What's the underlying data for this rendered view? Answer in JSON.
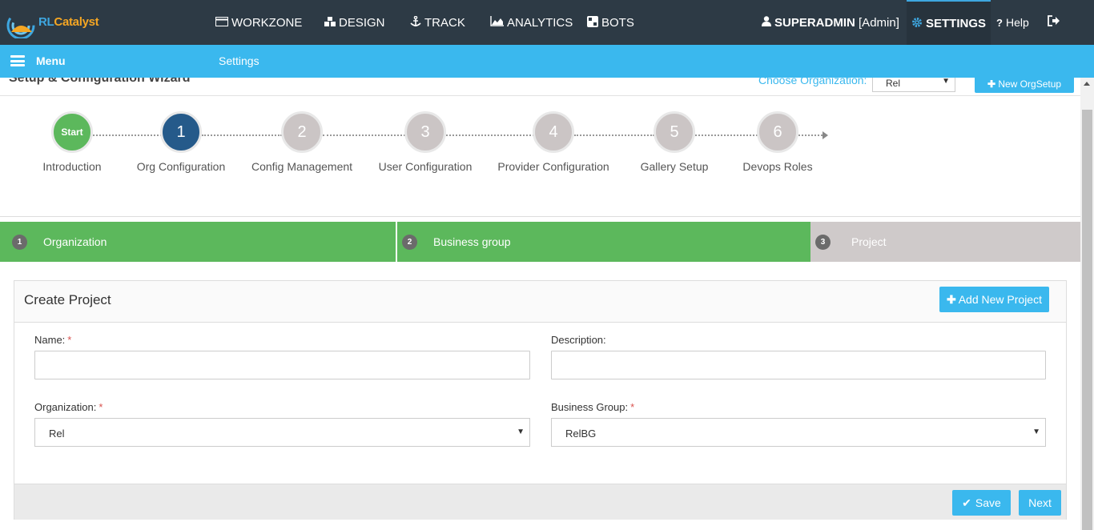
{
  "brand": {
    "name_part1": "RL",
    "name_part2": "Catalyst"
  },
  "topnav": {
    "items": [
      {
        "label": "WORKZONE",
        "icon": "card-icon"
      },
      {
        "label": "DESIGN",
        "icon": "cubes-icon"
      },
      {
        "label": "TRACK",
        "icon": "anchor-icon"
      },
      {
        "label": "ANALYTICS",
        "icon": "area-chart-icon"
      },
      {
        "label": "BOTS",
        "icon": "bots-icon"
      }
    ],
    "user": {
      "name": "SUPERADMIN",
      "role": "[Admin]"
    },
    "settings_label": "SETTINGS",
    "help_label": "Help"
  },
  "menubar": {
    "menu_label": "Menu",
    "breadcrumb": "Settings"
  },
  "wizard": {
    "title": "Setup & Configuration Wizard",
    "choose_org_label": "Choose Organization:",
    "org_selected": "Rel",
    "new_org_button": "New OrgSetup",
    "steps": [
      {
        "marker": "Start",
        "label": "Introduction",
        "state": "done"
      },
      {
        "marker": "1",
        "label": "Org Configuration",
        "state": "active"
      },
      {
        "marker": "2",
        "label": "Config Management",
        "state": "pending"
      },
      {
        "marker": "3",
        "label": "User Configuration",
        "state": "pending"
      },
      {
        "marker": "4",
        "label": "Provider Configuration",
        "state": "pending"
      },
      {
        "marker": "5",
        "label": "Gallery Setup",
        "state": "pending"
      },
      {
        "marker": "6",
        "label": "Devops Roles",
        "state": "pending"
      }
    ],
    "substeps": [
      {
        "num": "1",
        "label": "Organization",
        "state": "done"
      },
      {
        "num": "2",
        "label": "Business group",
        "state": "done"
      },
      {
        "num": "3",
        "label": "Project",
        "state": "current"
      }
    ]
  },
  "form": {
    "title": "Create Project",
    "add_button": "Add New Project",
    "name_label": "Name:",
    "name_value": "",
    "description_label": "Description:",
    "description_value": "",
    "organization_label": "Organization:",
    "organization_value": "Rel",
    "business_group_label": "Business Group:",
    "business_group_value": "RelBG",
    "required_marker": "*",
    "save_button": "Save",
    "next_button": "Next"
  },
  "colors": {
    "topbar": "#2d3a45",
    "accent": "#3ab8ee",
    "done_green": "#5cb85c",
    "active_blue": "#255a8a",
    "pending_grey": "#cbc5c5"
  }
}
